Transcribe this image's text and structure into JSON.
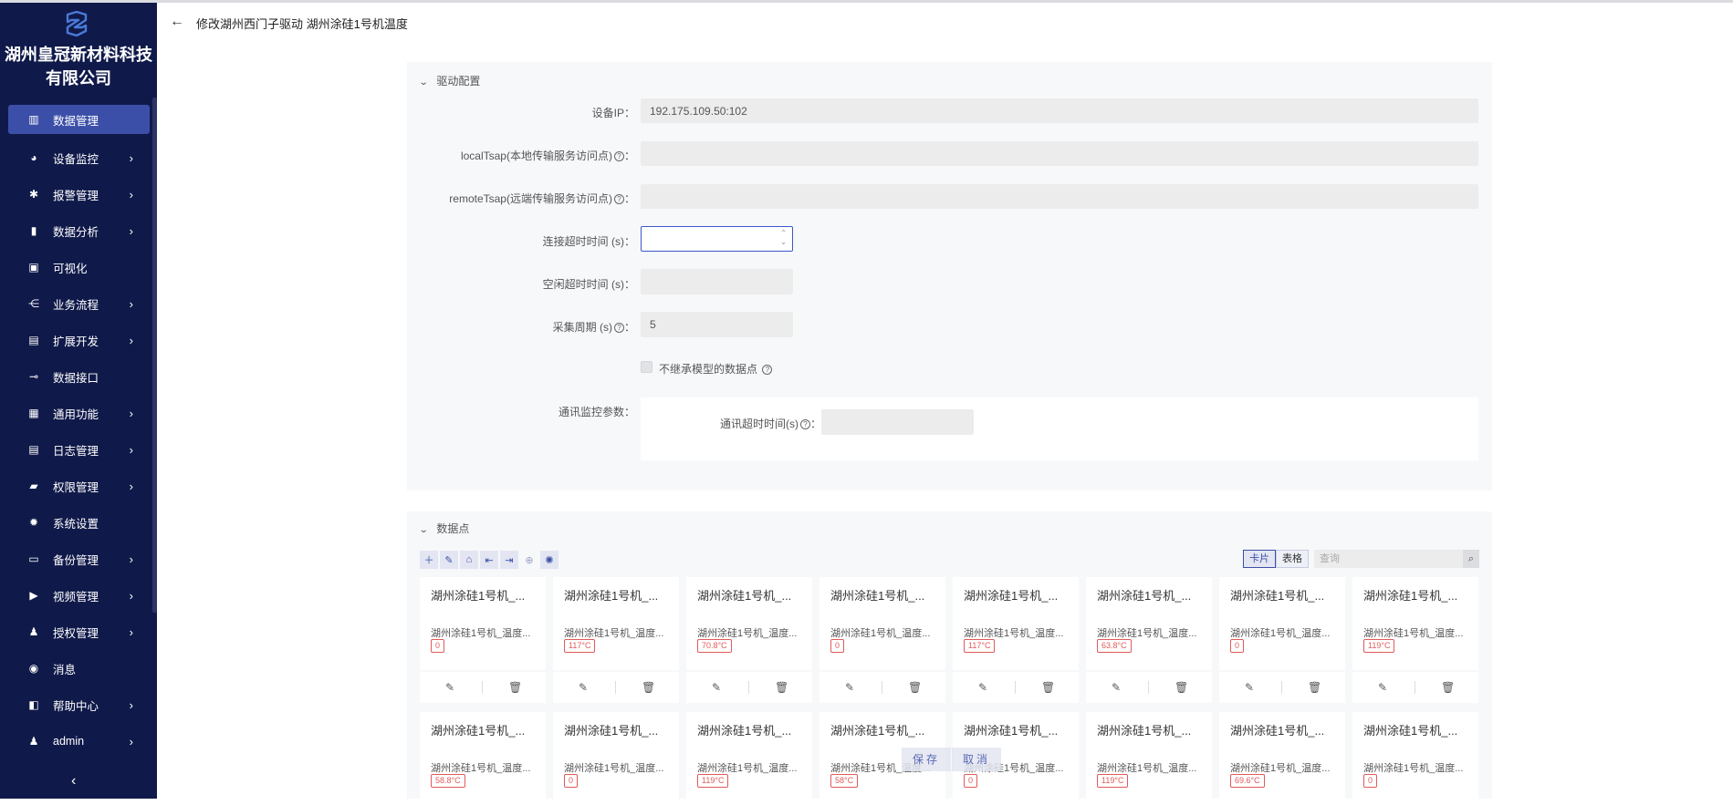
{
  "company": {
    "line1": "湖州皇冠新材料科技",
    "line2": "有限公司"
  },
  "sidebar": {
    "items": [
      {
        "label": "数据管理",
        "icon": "bar-chart-icon",
        "glyph": "▥",
        "active": true,
        "arrow": false
      },
      {
        "label": "设备监控",
        "icon": "pie-chart-icon",
        "glyph": "◕",
        "active": false,
        "arrow": true
      },
      {
        "label": "报警管理",
        "icon": "bell-icon",
        "glyph": "✱",
        "active": false,
        "arrow": true
      },
      {
        "label": "数据分析",
        "icon": "analysis-icon",
        "glyph": "▮",
        "active": false,
        "arrow": true
      },
      {
        "label": "可视化",
        "icon": "monitor-icon",
        "glyph": "▣",
        "active": false,
        "arrow": false
      },
      {
        "label": "业务流程",
        "icon": "flow-icon",
        "glyph": "⋲",
        "active": false,
        "arrow": true
      },
      {
        "label": "扩展开发",
        "icon": "extension-icon",
        "glyph": "▤",
        "active": false,
        "arrow": true
      },
      {
        "label": "数据接口",
        "icon": "plug-icon",
        "glyph": "⊸",
        "active": false,
        "arrow": false
      },
      {
        "label": "通用功能",
        "icon": "grid-icon",
        "glyph": "▦",
        "active": false,
        "arrow": true
      },
      {
        "label": "日志管理",
        "icon": "log-icon",
        "glyph": "▤",
        "active": false,
        "arrow": true
      },
      {
        "label": "权限管理",
        "icon": "lock-icon",
        "glyph": "▰",
        "active": false,
        "arrow": true
      },
      {
        "label": "系统设置",
        "icon": "gear-icon",
        "glyph": "✹",
        "active": false,
        "arrow": false
      },
      {
        "label": "备份管理",
        "icon": "backup-icon",
        "glyph": "▭",
        "active": false,
        "arrow": true
      },
      {
        "label": "视频管理",
        "icon": "video-icon",
        "glyph": "▶",
        "active": false,
        "arrow": true
      },
      {
        "label": "授权管理",
        "icon": "user-key-icon",
        "glyph": "♟",
        "active": false,
        "arrow": true
      },
      {
        "label": "消息",
        "icon": "message-icon",
        "glyph": "◉",
        "active": false,
        "arrow": false
      },
      {
        "label": "帮助中心",
        "icon": "help-icon",
        "glyph": "◧",
        "active": false,
        "arrow": true
      },
      {
        "label": "admin",
        "icon": "user-icon",
        "glyph": "♟",
        "active": false,
        "arrow": true
      }
    ],
    "collapse_glyph": "‹"
  },
  "header": {
    "back_glyph": "←",
    "title": "修改湖州西门子驱动 湖州涂硅1号机温度"
  },
  "driver_config": {
    "section_title": "驱动配置",
    "device_ip_label": "设备IP：",
    "device_ip_value": "192.175.109.50:102",
    "local_tsap_label": "localTsap(本地传输服务访问点)",
    "remote_tsap_label": "remoteTsap(远端传输服务访问点)",
    "connect_timeout_label": "连接超时时间 (s)：",
    "idle_timeout_label": "空闲超时时间 (s)：",
    "collect_period_label": "采集周期 (s)",
    "collect_period_value": "5",
    "inherit_label": "不继承模型的数据点",
    "comm_monitor_label": "通讯监控参数：",
    "comm_timeout_label": "通讯超时时间(s)",
    "colon": "：",
    "qmark": "?"
  },
  "datapoints": {
    "section_title": "数据点",
    "view_card": "卡片",
    "view_table": "表格",
    "search_placeholder": "查询",
    "cards": [
      {
        "title": "湖州涂硅1号机_...",
        "sub": "湖州涂硅1号机_温度...",
        "value": "0"
      },
      {
        "title": "湖州涂硅1号机_...",
        "sub": "湖州涂硅1号机_温度...",
        "value": "117°C"
      },
      {
        "title": "湖州涂硅1号机_...",
        "sub": "湖州涂硅1号机_温度...",
        "value": "70.8°C"
      },
      {
        "title": "湖州涂硅1号机_...",
        "sub": "湖州涂硅1号机_温度...",
        "value": "0"
      },
      {
        "title": "湖州涂硅1号机_...",
        "sub": "湖州涂硅1号机_温度...",
        "value": "117°C"
      },
      {
        "title": "湖州涂硅1号机_...",
        "sub": "湖州涂硅1号机_温度...",
        "value": "63.8°C"
      },
      {
        "title": "湖州涂硅1号机_...",
        "sub": "湖州涂硅1号机_温度...",
        "value": "0"
      },
      {
        "title": "湖州涂硅1号机_...",
        "sub": "湖州涂硅1号机_温度...",
        "value": "119°C"
      },
      {
        "title": "湖州涂硅1号机_...",
        "sub": "湖州涂硅1号机_温度...",
        "value": "58.8°C"
      },
      {
        "title": "湖州涂硅1号机_...",
        "sub": "湖州涂硅1号机_温度...",
        "value": "0"
      },
      {
        "title": "湖州涂硅1号机_...",
        "sub": "湖州涂硅1号机_温度...",
        "value": "119°C"
      },
      {
        "title": "湖州涂硅1号机_...",
        "sub": "湖州涂硅1号机_温度...",
        "value": "58°C"
      },
      {
        "title": "湖州涂硅1号机_...",
        "sub": "湖州涂硅1号机_温度...",
        "value": "0"
      },
      {
        "title": "湖州涂硅1号机_...",
        "sub": "湖州涂硅1号机_温度...",
        "value": "119°C"
      },
      {
        "title": "湖州涂硅1号机_...",
        "sub": "湖州涂硅1号机_温度...",
        "value": "69.6°C"
      },
      {
        "title": "湖州涂硅1号机_...",
        "sub": "湖州涂硅1号机_温度...",
        "value": "0"
      }
    ]
  },
  "footer": {
    "save": "保存",
    "cancel": "取消"
  },
  "colors": {
    "sidebar_bg": "#101a4a",
    "active_bg": "#3c4fa8",
    "value_red": "#e05b5b"
  }
}
